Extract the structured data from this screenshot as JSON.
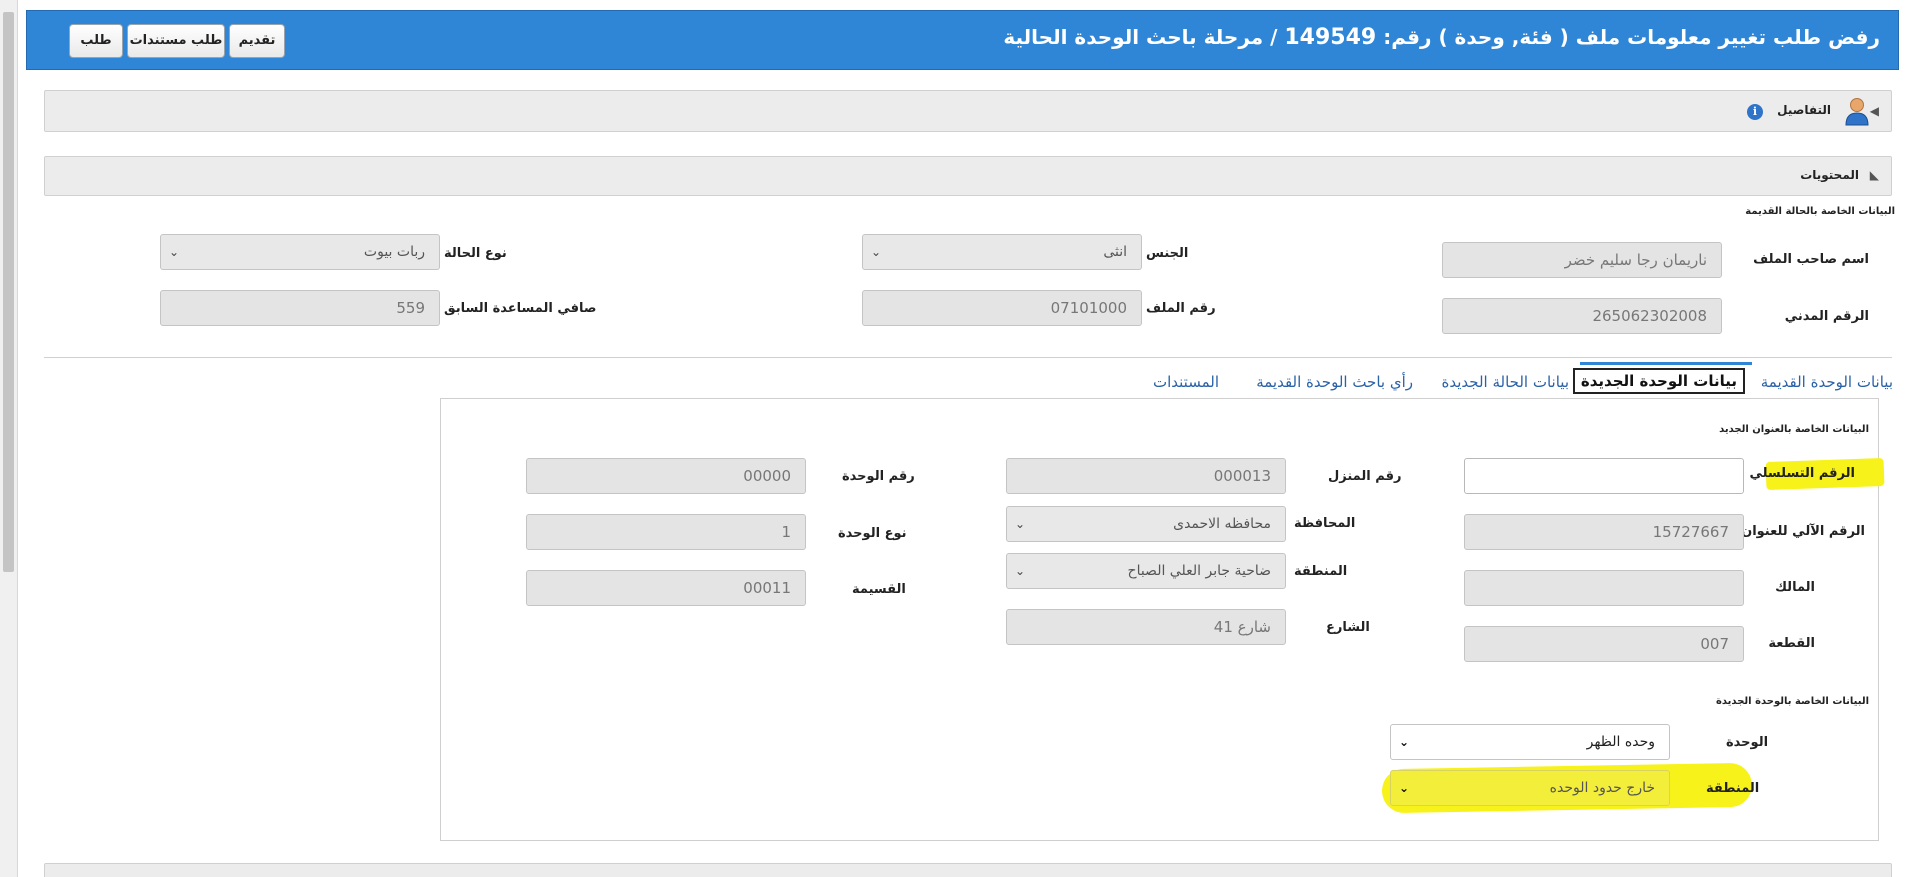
{
  "header": {
    "title_prefix": "رفض طلب تغيير معلومات ملف ( فئة, وحدة ) رقم: ",
    "title_number": "149549",
    "title_suffix": " / مرحلة باحث الوحدة الحالية",
    "buttons": {
      "submit": "تقديم",
      "request_docs": "طلب مستندات",
      "request": "طلب"
    }
  },
  "details_bar": {
    "label": "التفاصيل"
  },
  "contents_bar": {
    "label": "المحتويات"
  },
  "old_case": {
    "section_title": "البيانات الخاصة بالحالة القديمة",
    "owner_name": {
      "label": "اسم صاحب الملف",
      "value": "ناريمان رجا سليم خضر"
    },
    "gender": {
      "label": "الجنس",
      "value": "انثى"
    },
    "case_type": {
      "label": "نوع الحالة",
      "value": "ربات بيوت"
    },
    "civil_id": {
      "label": "الرقم المدني",
      "value": "265062302008"
    },
    "file_no": {
      "label": "رقم الملف",
      "value": "07101000"
    },
    "prev_aid": {
      "label": "صافي المساعدة السابق",
      "value": "559"
    }
  },
  "tabs": [
    {
      "label": "بيانات الوحدة القديمة"
    },
    {
      "label": "بيانات الوحدة الجديدة"
    },
    {
      "label": "بيانات الحالة الجديدة"
    },
    {
      "label": "رأي باحث الوحدة القديمة"
    },
    {
      "label": "المستندات"
    }
  ],
  "new_address": {
    "section_title": "البيانات الخاصة بالعنوان الجديد",
    "serial_no": {
      "label": "الرقم التسلسلي",
      "value": ""
    },
    "auto_no": {
      "label": "الرقم الآلي للعنوان",
      "value": "15727667"
    },
    "owner": {
      "label": "المالك",
      "value": ""
    },
    "plot": {
      "label": "القطعة",
      "value": "007"
    },
    "house_no": {
      "label": "رقم المنزل",
      "value": "000013"
    },
    "governorate": {
      "label": "المحافظة",
      "value": "محافظه الاحمدى"
    },
    "area": {
      "label": "المنطقة",
      "value": "ضاحية جابر العلي الصباح"
    },
    "street": {
      "label": "الشارع",
      "value": "شارع 41"
    },
    "unit_no": {
      "label": "رقم الوحدة",
      "value": "00000"
    },
    "unit_type": {
      "label": "نوع الوحدة",
      "value": "1"
    },
    "voucher": {
      "label": "القسيمة",
      "value": "00011"
    }
  },
  "new_unit": {
    "section_title": "البيانات الخاصة بالوحدة الجديدة",
    "unit": {
      "label": "الوحدة",
      "value": "وحده الظهر"
    },
    "region": {
      "label": "المنطقة",
      "value": "خارج حدود الوحده"
    }
  },
  "colors": {
    "header_bg": "#2f86d6",
    "highlight": "#f7f21a",
    "tab_link": "#2a62a8"
  }
}
